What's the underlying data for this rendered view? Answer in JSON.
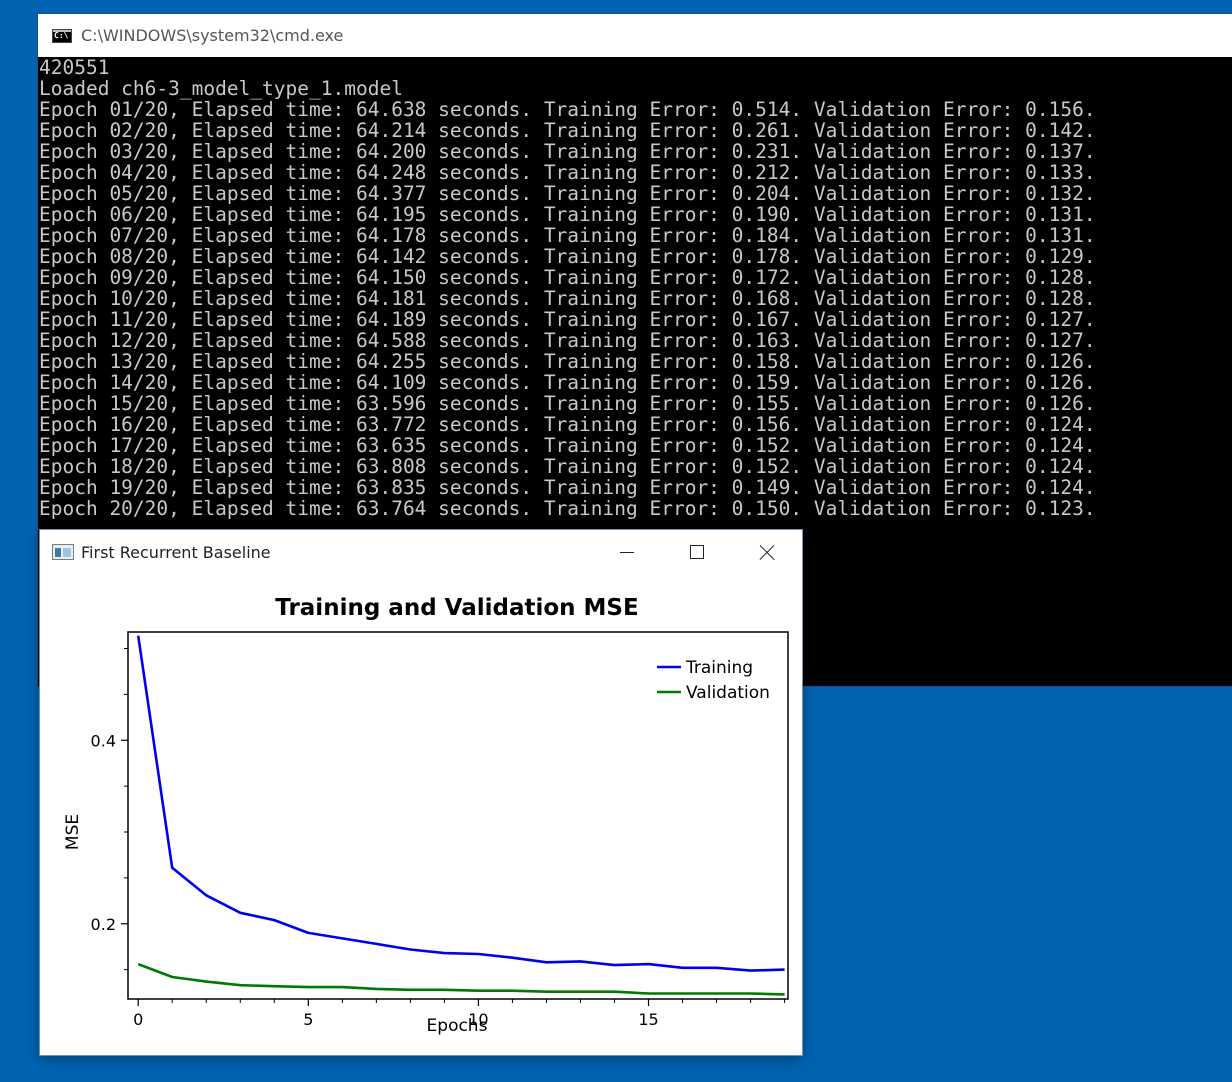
{
  "console": {
    "title": "C:\\WINDOWS\\system32\\cmd.exe",
    "icon": "console-icon",
    "lines": [
      "420551",
      "Loaded ch6-3_model_type_1.model",
      "Epoch 01/20, Elapsed time: 64.638 seconds. Training Error: 0.514. Validation Error: 0.156.",
      "Epoch 02/20, Elapsed time: 64.214 seconds. Training Error: 0.261. Validation Error: 0.142.",
      "Epoch 03/20, Elapsed time: 64.200 seconds. Training Error: 0.231. Validation Error: 0.137.",
      "Epoch 04/20, Elapsed time: 64.248 seconds. Training Error: 0.212. Validation Error: 0.133.",
      "Epoch 05/20, Elapsed time: 64.377 seconds. Training Error: 0.204. Validation Error: 0.132.",
      "Epoch 06/20, Elapsed time: 64.195 seconds. Training Error: 0.190. Validation Error: 0.131.",
      "Epoch 07/20, Elapsed time: 64.178 seconds. Training Error: 0.184. Validation Error: 0.131.",
      "Epoch 08/20, Elapsed time: 64.142 seconds. Training Error: 0.178. Validation Error: 0.129.",
      "Epoch 09/20, Elapsed time: 64.150 seconds. Training Error: 0.172. Validation Error: 0.128.",
      "Epoch 10/20, Elapsed time: 64.181 seconds. Training Error: 0.168. Validation Error: 0.128.",
      "Epoch 11/20, Elapsed time: 64.189 seconds. Training Error: 0.167. Validation Error: 0.127.",
      "Epoch 12/20, Elapsed time: 64.588 seconds. Training Error: 0.163. Validation Error: 0.127.",
      "Epoch 13/20, Elapsed time: 64.255 seconds. Training Error: 0.158. Validation Error: 0.126.",
      "Epoch 14/20, Elapsed time: 64.109 seconds. Training Error: 0.159. Validation Error: 0.126.",
      "Epoch 15/20, Elapsed time: 63.596 seconds. Training Error: 0.155. Validation Error: 0.126.",
      "Epoch 16/20, Elapsed time: 63.772 seconds. Training Error: 0.156. Validation Error: 0.124.",
      "Epoch 17/20, Elapsed time: 63.635 seconds. Training Error: 0.152. Validation Error: 0.124.",
      "Epoch 18/20, Elapsed time: 63.808 seconds. Training Error: 0.152. Validation Error: 0.124.",
      "Epoch 19/20, Elapsed time: 63.835 seconds. Training Error: 0.149. Validation Error: 0.124.",
      "Epoch 20/20, Elapsed time: 63.764 seconds. Training Error: 0.150. Validation Error: 0.123."
    ]
  },
  "plot_window": {
    "title": "First Recurrent Baseline",
    "icon": "plot-window-icon",
    "controls": {
      "minimize": "minimize-icon",
      "maximize": "maximize-icon",
      "close": "close-icon"
    }
  },
  "chart_data": {
    "type": "line",
    "title": "Training and Validation MSE",
    "xlabel": "Epochs",
    "ylabel": "MSE",
    "x": [
      0,
      1,
      2,
      3,
      4,
      5,
      6,
      7,
      8,
      9,
      10,
      11,
      12,
      13,
      14,
      15,
      16,
      17,
      18,
      19
    ],
    "series": [
      {
        "name": "Training",
        "color": "#0000ee",
        "values": [
          0.514,
          0.261,
          0.231,
          0.212,
          0.204,
          0.19,
          0.184,
          0.178,
          0.172,
          0.168,
          0.167,
          0.163,
          0.158,
          0.159,
          0.155,
          0.156,
          0.152,
          0.152,
          0.149,
          0.15
        ]
      },
      {
        "name": "Validation",
        "color": "#007a00",
        "values": [
          0.156,
          0.142,
          0.137,
          0.133,
          0.132,
          0.131,
          0.131,
          0.129,
          0.128,
          0.128,
          0.127,
          0.127,
          0.126,
          0.126,
          0.126,
          0.124,
          0.124,
          0.124,
          0.124,
          0.123
        ]
      }
    ],
    "xlim": [
      -0.3,
      19.1
    ],
    "ylim": [
      0.118,
      0.518
    ],
    "xticks": [
      0,
      5,
      10,
      15
    ],
    "xticks_minor": [
      1,
      2,
      3,
      4,
      6,
      7,
      8,
      9,
      11,
      12,
      13,
      14,
      16,
      17,
      18,
      19
    ],
    "yticks": [
      0.2,
      0.4
    ],
    "yticks_minor": [
      0.15,
      0.25,
      0.3,
      0.35,
      0.45,
      0.5
    ],
    "ytick_labels": [
      "0.2",
      "0.4"
    ],
    "xtick_labels": [
      "0",
      "5",
      "10",
      "15"
    ],
    "legend_position": "top-right",
    "grid": false
  }
}
